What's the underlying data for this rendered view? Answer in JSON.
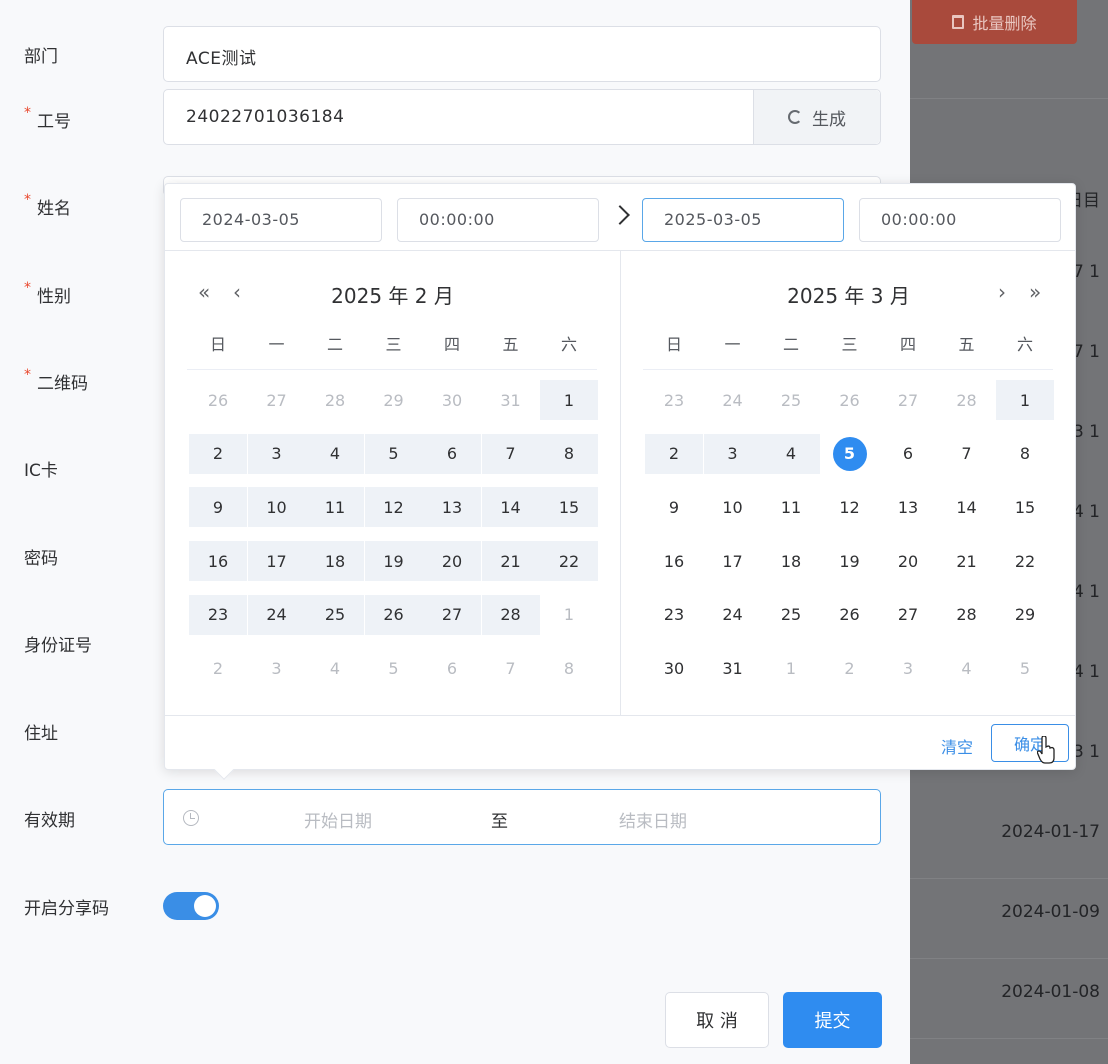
{
  "background": {
    "batch_delete_label": "批量删除",
    "header_partial": "日目",
    "column_partial": [
      "7 1",
      "7 1",
      "3 1",
      "4 1",
      "4 1",
      "4 1",
      "3 1"
    ],
    "dates": [
      "2024-01-17",
      "2024-01-09",
      "2024-01-08"
    ]
  },
  "form": {
    "department": {
      "label": "部门",
      "value": "ACE测试"
    },
    "employee_id": {
      "label": "工号",
      "value": "24022701036184",
      "generate_label": "生成"
    },
    "name": {
      "label": "姓名"
    },
    "gender": {
      "label": "性别"
    },
    "qrcode": {
      "label": "二维码"
    },
    "ic_card": {
      "label": "IC卡"
    },
    "password": {
      "label": "密码"
    },
    "id_number": {
      "label": "身份证号"
    },
    "address": {
      "label": "住址"
    },
    "validity": {
      "label": "有效期",
      "start_placeholder": "开始日期",
      "separator": "至",
      "end_placeholder": "结束日期"
    },
    "share_code": {
      "label": "开启分享码",
      "enabled": true
    },
    "required_mark": "*"
  },
  "footer": {
    "cancel_label": "取 消",
    "submit_label": "提交"
  },
  "picker": {
    "start_date": "2024-03-05",
    "start_time": "00:00:00",
    "end_date": "2025-03-05",
    "end_time": "00:00:00",
    "weekdays": [
      "日",
      "一",
      "二",
      "三",
      "四",
      "五",
      "六"
    ],
    "left": {
      "title": "2025 年 2 月",
      "prev_year": "«",
      "prev_month": "‹",
      "days": [
        [
          "26",
          "27",
          "28",
          "29",
          "30",
          "31",
          "1"
        ],
        [
          "2",
          "3",
          "4",
          "5",
          "6",
          "7",
          "8"
        ],
        [
          "9",
          "10",
          "11",
          "12",
          "13",
          "14",
          "15"
        ],
        [
          "16",
          "17",
          "18",
          "19",
          "20",
          "21",
          "22"
        ],
        [
          "23",
          "24",
          "25",
          "26",
          "27",
          "28",
          "1"
        ],
        [
          "2",
          "3",
          "4",
          "5",
          "6",
          "7",
          "8"
        ]
      ]
    },
    "right": {
      "title": "2025 年 3 月",
      "next_month": "›",
      "next_year": "»",
      "days": [
        [
          "23",
          "24",
          "25",
          "26",
          "27",
          "28",
          "1"
        ],
        [
          "2",
          "3",
          "4",
          "5",
          "6",
          "7",
          "8"
        ],
        [
          "9",
          "10",
          "11",
          "12",
          "13",
          "14",
          "15"
        ],
        [
          "16",
          "17",
          "18",
          "19",
          "20",
          "21",
          "22"
        ],
        [
          "23",
          "24",
          "25",
          "26",
          "27",
          "28",
          "29"
        ],
        [
          "30",
          "31",
          "1",
          "2",
          "3",
          "4",
          "5"
        ]
      ]
    },
    "clear_label": "清空",
    "ok_label": "确定"
  },
  "colors": {
    "primary": "#2f8cf0",
    "required": "#e9472c",
    "range_bg": "#eef2f7"
  }
}
